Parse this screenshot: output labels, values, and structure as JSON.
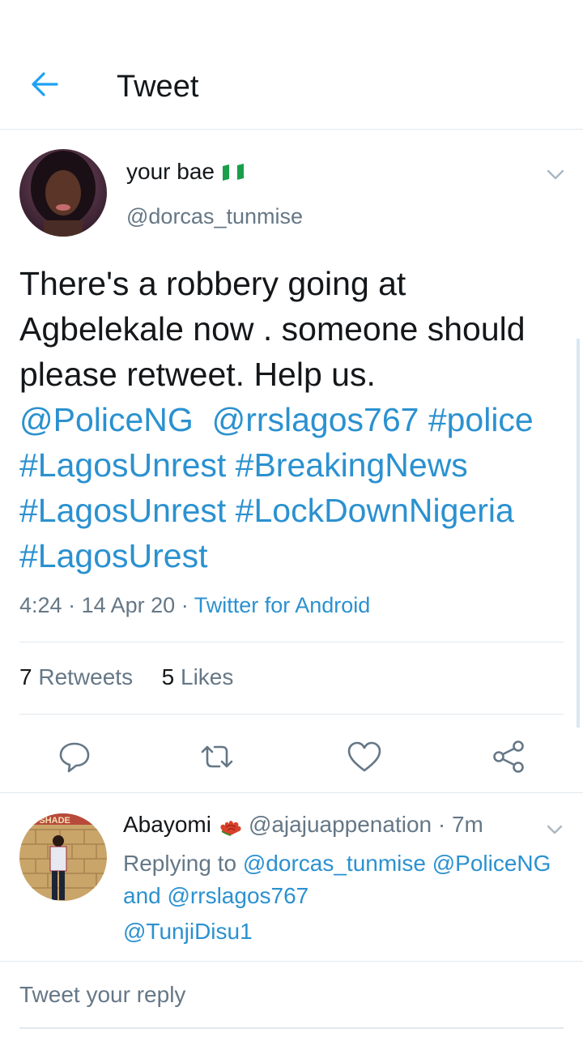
{
  "header": {
    "title": "Tweet",
    "back_icon": "arrow-left-icon"
  },
  "tweet": {
    "display_name": "your bae",
    "flag_icon": "nigeria-flag-icon",
    "handle": "@dorcas_tunmise",
    "text_lines": [
      "There's a robbery going at",
      "Agbelekale now . someone should",
      "please retweet. Help us."
    ],
    "link_lines": [
      "@PoliceNG  @rrslagos767 #police",
      "#LagosUnrest #BreakingNews",
      "#LagosUnrest #LockDownNigeria",
      "#LagosUrest"
    ],
    "time": "4:24",
    "date": "14 Apr 20",
    "source": "Twitter for Android",
    "retweets_count": "7",
    "retweets_label": "Retweets",
    "likes_count": "5",
    "likes_label": "Likes"
  },
  "reply": {
    "name": "Abayomi",
    "handle_time": "@ajajuappenation · 7m",
    "replying_prefix": "Replying to",
    "replying_to_1": "@dorcas_tunmise",
    "replying_to_2": "@PoliceNG",
    "replying_and": "and",
    "replying_to_3": "@rrslagos767",
    "text": "@TunjiDisu1"
  },
  "composer": {
    "placeholder": "Tweet your reply"
  },
  "colors": {
    "link": "#2b91d0",
    "secondary": "#657786",
    "primary": "#14171a"
  }
}
